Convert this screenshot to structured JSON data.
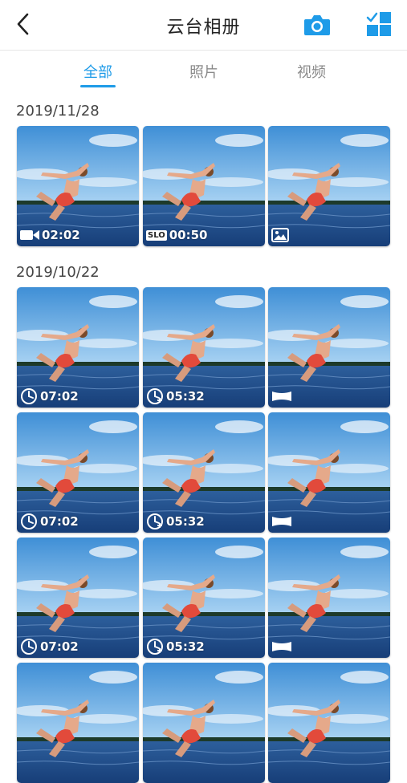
{
  "header": {
    "title": "云台相册",
    "back_icon": "chevron-left-icon",
    "camera_icon": "camera-icon",
    "select_icon": "multi-select-grid-icon",
    "accent_color": "#1e9be8"
  },
  "tabs": [
    {
      "label": "全部",
      "active": true
    },
    {
      "label": "照片",
      "active": false
    },
    {
      "label": "视频",
      "active": false
    }
  ],
  "groups": [
    {
      "date": "2019/11/28",
      "items": [
        {
          "type": "video",
          "icon": "video-camera-icon",
          "duration": "02:02"
        },
        {
          "type": "slow-motion",
          "icon": "slo-badge-icon",
          "slo_label": "SLO",
          "duration": "00:50"
        },
        {
          "type": "photo",
          "icon": "image-icon",
          "duration": ""
        }
      ]
    },
    {
      "date": "2019/10/22",
      "items": [
        {
          "type": "timelapse",
          "icon": "timelapse-clock-icon",
          "duration": "07:02"
        },
        {
          "type": "hyperlapse",
          "icon": "hyperlapse-clock-icon",
          "duration": "05:32"
        },
        {
          "type": "panorama",
          "icon": "panorama-icon",
          "duration": ""
        },
        {
          "type": "timelapse",
          "icon": "timelapse-clock-icon",
          "duration": "07:02"
        },
        {
          "type": "hyperlapse",
          "icon": "hyperlapse-clock-icon",
          "duration": "05:32"
        },
        {
          "type": "panorama",
          "icon": "panorama-icon",
          "duration": ""
        },
        {
          "type": "timelapse",
          "icon": "timelapse-clock-icon",
          "duration": "07:02"
        },
        {
          "type": "hyperlapse",
          "icon": "hyperlapse-clock-icon",
          "duration": "05:32"
        },
        {
          "type": "panorama",
          "icon": "panorama-icon",
          "duration": ""
        },
        {
          "type": "partial",
          "icon": "",
          "duration": ""
        },
        {
          "type": "partial",
          "icon": "",
          "duration": ""
        },
        {
          "type": "partial",
          "icon": "",
          "duration": ""
        }
      ]
    }
  ]
}
